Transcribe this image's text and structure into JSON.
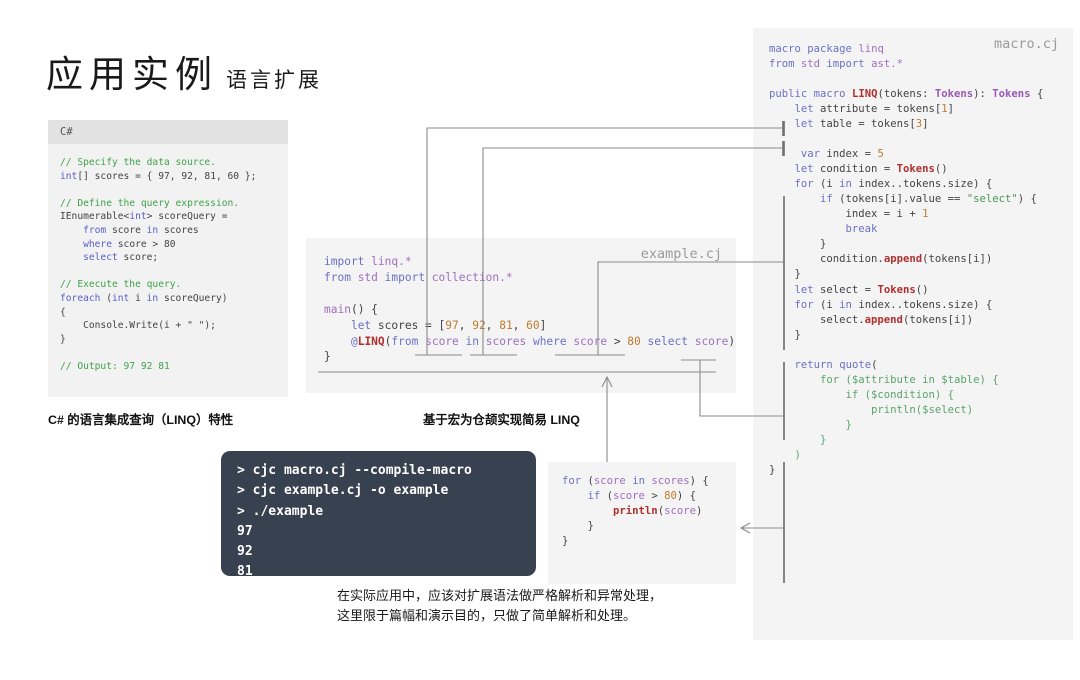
{
  "title": {
    "main": "应用实例",
    "sub": "语言扩展"
  },
  "csharp_panel": {
    "header": "C#",
    "lines": [
      [
        {
          "t": "// Specify the data source.",
          "c": "cm"
        }
      ],
      [
        {
          "t": "int",
          "c": "kb"
        },
        {
          "t": "[] scores = { ",
          "c": "pl"
        },
        {
          "t": "97",
          "c": "pl"
        },
        {
          "t": ", 92, 81, 60 };",
          "c": "pl"
        }
      ],
      [
        {
          "t": "",
          "c": "pl"
        }
      ],
      [
        {
          "t": "// Define the query expression.",
          "c": "cm"
        }
      ],
      [
        {
          "t": "IEnumerable<",
          "c": "pl"
        },
        {
          "t": "int",
          "c": "kb"
        },
        {
          "t": "> scoreQuery =",
          "c": "pl"
        }
      ],
      [
        {
          "t": "    ",
          "c": "pl"
        },
        {
          "t": "from",
          "c": "kb"
        },
        {
          "t": " score ",
          "c": "pl"
        },
        {
          "t": "in",
          "c": "kb"
        },
        {
          "t": " scores",
          "c": "pl"
        }
      ],
      [
        {
          "t": "    ",
          "c": "pl"
        },
        {
          "t": "where",
          "c": "kb"
        },
        {
          "t": " score > 80",
          "c": "pl"
        }
      ],
      [
        {
          "t": "    ",
          "c": "pl"
        },
        {
          "t": "select",
          "c": "kb"
        },
        {
          "t": " score;",
          "c": "pl"
        }
      ],
      [
        {
          "t": "",
          "c": "pl"
        }
      ],
      [
        {
          "t": "// Execute the query.",
          "c": "cm"
        }
      ],
      [
        {
          "t": "foreach",
          "c": "kb"
        },
        {
          "t": " (",
          "c": "pl"
        },
        {
          "t": "int",
          "c": "kb"
        },
        {
          "t": " i ",
          "c": "pl"
        },
        {
          "t": "in",
          "c": "kb"
        },
        {
          "t": " scoreQuery)",
          "c": "pl"
        }
      ],
      [
        {
          "t": "{",
          "c": "pl"
        }
      ],
      [
        {
          "t": "    Console.Write(i + \" \");",
          "c": "pl"
        }
      ],
      [
        {
          "t": "}",
          "c": "pl"
        }
      ],
      [
        {
          "t": "",
          "c": "pl"
        }
      ],
      [
        {
          "t": "// Output: 97 92 81",
          "c": "cm"
        }
      ]
    ]
  },
  "example_panel": {
    "filename": "example.cj",
    "lines": [
      [
        {
          "t": "import",
          "c": "k"
        },
        {
          "t": " linq.*",
          "c": "id"
        }
      ],
      [
        {
          "t": "from",
          "c": "k"
        },
        {
          "t": " std ",
          "c": "id"
        },
        {
          "t": "import",
          "c": "k"
        },
        {
          "t": " collection.*",
          "c": "id"
        }
      ],
      [
        {
          "t": "",
          "c": "pl"
        }
      ],
      [
        {
          "t": "main",
          "c": "id"
        },
        {
          "t": "() {",
          "c": "pl"
        }
      ],
      [
        {
          "t": "    ",
          "c": "pl"
        },
        {
          "t": "let",
          "c": "k"
        },
        {
          "t": " scores = [",
          "c": "pl"
        },
        {
          "t": "97",
          "c": "num"
        },
        {
          "t": ", ",
          "c": "pl"
        },
        {
          "t": "92",
          "c": "num"
        },
        {
          "t": ", ",
          "c": "pl"
        },
        {
          "t": "81",
          "c": "num"
        },
        {
          "t": ", ",
          "c": "pl"
        },
        {
          "t": "60",
          "c": "num"
        },
        {
          "t": "]",
          "c": "pl"
        }
      ],
      [
        {
          "t": "    ",
          "c": "pl"
        },
        {
          "t": "@",
          "c": "k"
        },
        {
          "t": "LINQ",
          "c": "fn"
        },
        {
          "t": "(",
          "c": "pl"
        },
        {
          "t": "from",
          "c": "k"
        },
        {
          "t": " ",
          "c": "pl"
        },
        {
          "t": "score",
          "c": "id"
        },
        {
          "t": " ",
          "c": "pl"
        },
        {
          "t": "in",
          "c": "k"
        },
        {
          "t": " ",
          "c": "pl"
        },
        {
          "t": "scores",
          "c": "id"
        },
        {
          "t": " ",
          "c": "pl"
        },
        {
          "t": "where",
          "c": "k"
        },
        {
          "t": " ",
          "c": "pl"
        },
        {
          "t": "score",
          "c": "id"
        },
        {
          "t": " > ",
          "c": "pl"
        },
        {
          "t": "80",
          "c": "num"
        },
        {
          "t": " ",
          "c": "pl"
        },
        {
          "t": "select",
          "c": "k"
        },
        {
          "t": " ",
          "c": "pl"
        },
        {
          "t": "score",
          "c": "id"
        },
        {
          "t": ")",
          "c": "pl"
        }
      ],
      [
        {
          "t": "}",
          "c": "pl"
        }
      ]
    ]
  },
  "macro_panel": {
    "filename": "macro.cj",
    "lines": [
      [
        {
          "t": "macro",
          "c": "k"
        },
        {
          "t": " ",
          "c": "pl"
        },
        {
          "t": "package",
          "c": "k"
        },
        {
          "t": " linq",
          "c": "id"
        }
      ],
      [
        {
          "t": "from",
          "c": "k"
        },
        {
          "t": " std ",
          "c": "id"
        },
        {
          "t": "import",
          "c": "k"
        },
        {
          "t": " ast.*",
          "c": "id"
        }
      ],
      [
        {
          "t": "",
          "c": "pl"
        }
      ],
      [
        {
          "t": "public",
          "c": "k"
        },
        {
          "t": " ",
          "c": "pl"
        },
        {
          "t": "macro",
          "c": "k"
        },
        {
          "t": " ",
          "c": "pl"
        },
        {
          "t": "LINQ",
          "c": "fn"
        },
        {
          "t": "(tokens: ",
          "c": "pl"
        },
        {
          "t": "Tokens",
          "c": "ty"
        },
        {
          "t": "): ",
          "c": "pl"
        },
        {
          "t": "Tokens",
          "c": "ty"
        },
        {
          "t": " {",
          "c": "pl"
        }
      ],
      [
        {
          "t": "    ",
          "c": "pl"
        },
        {
          "t": "let",
          "c": "k"
        },
        {
          "t": " attribute = tokens[",
          "c": "pl"
        },
        {
          "t": "1",
          "c": "num"
        },
        {
          "t": "]",
          "c": "pl"
        }
      ],
      [
        {
          "t": "    ",
          "c": "pl"
        },
        {
          "t": "let",
          "c": "k"
        },
        {
          "t": " table = tokens[",
          "c": "pl"
        },
        {
          "t": "3",
          "c": "num"
        },
        {
          "t": "]",
          "c": "pl"
        }
      ],
      [
        {
          "t": "",
          "c": "pl"
        }
      ],
      [
        {
          "t": "     ",
          "c": "pl"
        },
        {
          "t": "var",
          "c": "k"
        },
        {
          "t": " index = ",
          "c": "pl"
        },
        {
          "t": "5",
          "c": "num"
        }
      ],
      [
        {
          "t": "    ",
          "c": "pl"
        },
        {
          "t": "let",
          "c": "k"
        },
        {
          "t": " condition = ",
          "c": "pl"
        },
        {
          "t": "Tokens",
          "c": "fn"
        },
        {
          "t": "()",
          "c": "pl"
        }
      ],
      [
        {
          "t": "    ",
          "c": "pl"
        },
        {
          "t": "for",
          "c": "k"
        },
        {
          "t": " (i ",
          "c": "pl"
        },
        {
          "t": "in",
          "c": "k"
        },
        {
          "t": " index..tokens.size) {",
          "c": "pl"
        }
      ],
      [
        {
          "t": "        ",
          "c": "pl"
        },
        {
          "t": "if",
          "c": "k"
        },
        {
          "t": " (tokens[i].value == ",
          "c": "pl"
        },
        {
          "t": "\"select\"",
          "c": "st"
        },
        {
          "t": ") {",
          "c": "pl"
        }
      ],
      [
        {
          "t": "            index = i + ",
          "c": "pl"
        },
        {
          "t": "1",
          "c": "num"
        }
      ],
      [
        {
          "t": "            ",
          "c": "pl"
        },
        {
          "t": "break",
          "c": "k"
        }
      ],
      [
        {
          "t": "        }",
          "c": "pl"
        }
      ],
      [
        {
          "t": "        condition.",
          "c": "pl"
        },
        {
          "t": "append",
          "c": "fn"
        },
        {
          "t": "(tokens[i])",
          "c": "pl"
        }
      ],
      [
        {
          "t": "    }",
          "c": "pl"
        }
      ],
      [
        {
          "t": "    ",
          "c": "pl"
        },
        {
          "t": "let",
          "c": "k"
        },
        {
          "t": " select = ",
          "c": "pl"
        },
        {
          "t": "Tokens",
          "c": "fn"
        },
        {
          "t": "()",
          "c": "pl"
        }
      ],
      [
        {
          "t": "    ",
          "c": "pl"
        },
        {
          "t": "for",
          "c": "k"
        },
        {
          "t": " (i ",
          "c": "pl"
        },
        {
          "t": "in",
          "c": "k"
        },
        {
          "t": " index..tokens.size) {",
          "c": "pl"
        }
      ],
      [
        {
          "t": "        select.",
          "c": "pl"
        },
        {
          "t": "append",
          "c": "fn"
        },
        {
          "t": "(tokens[i])",
          "c": "pl"
        }
      ],
      [
        {
          "t": "    }",
          "c": "pl"
        }
      ],
      [
        {
          "t": "",
          "c": "pl"
        }
      ],
      [
        {
          "t": "    ",
          "c": "pl"
        },
        {
          "t": "return",
          "c": "k"
        },
        {
          "t": " ",
          "c": "pl"
        },
        {
          "t": "quote",
          "c": "k"
        },
        {
          "t": "(",
          "c": "pl"
        }
      ],
      [
        {
          "t": "        for ($attribute in $table) {",
          "c": "gr"
        }
      ],
      [
        {
          "t": "            if ($condition) {",
          "c": "gr"
        }
      ],
      [
        {
          "t": "                println($select)",
          "c": "gr"
        }
      ],
      [
        {
          "t": "            }",
          "c": "gr"
        }
      ],
      [
        {
          "t": "        }",
          "c": "gr"
        }
      ],
      [
        {
          "t": "    )",
          "c": "gr"
        }
      ],
      [
        {
          "t": "}",
          "c": "pl"
        }
      ]
    ]
  },
  "expanded_panel": {
    "lines": [
      [
        {
          "t": "for",
          "c": "k"
        },
        {
          "t": " (",
          "c": "pl"
        },
        {
          "t": "score",
          "c": "id"
        },
        {
          "t": " ",
          "c": "pl"
        },
        {
          "t": "in",
          "c": "k"
        },
        {
          "t": " ",
          "c": "pl"
        },
        {
          "t": "scores",
          "c": "id"
        },
        {
          "t": ") {",
          "c": "pl"
        }
      ],
      [
        {
          "t": "    ",
          "c": "pl"
        },
        {
          "t": "if",
          "c": "k"
        },
        {
          "t": " (",
          "c": "pl"
        },
        {
          "t": "score",
          "c": "id"
        },
        {
          "t": " > ",
          "c": "pl"
        },
        {
          "t": "80",
          "c": "num"
        },
        {
          "t": ") {",
          "c": "pl"
        }
      ],
      [
        {
          "t": "        ",
          "c": "pl"
        },
        {
          "t": "println",
          "c": "fn"
        },
        {
          "t": "(",
          "c": "pl"
        },
        {
          "t": "score",
          "c": "id"
        },
        {
          "t": ")",
          "c": "pl"
        }
      ],
      [
        {
          "t": "    }",
          "c": "pl"
        }
      ],
      [
        {
          "t": "}",
          "c": "pl"
        }
      ]
    ]
  },
  "terminal": {
    "lines": [
      "> cjc macro.cj --compile-macro",
      "> cjc example.cj -o example",
      "> ./example",
      "97",
      "92",
      "81"
    ]
  },
  "captions": {
    "csharp": "C#  的语言集成查询（LINQ）特性",
    "cangjie": "基于宏为仓颉实现简易  LINQ"
  },
  "note": {
    "line1": "在实际应用中，应该对扩展语法做严格解析和异常处理，",
    "line2": "这里限于篇幅和演示目的，只做了简单解析和处理。"
  },
  "colors": {
    "panel_bg": "#f4f4f4",
    "terminal_bg": "#38414f",
    "connector": "#8a8a8a",
    "keyword": "#6c71c4",
    "comment": "#3fa34a",
    "number": "#c07a2c",
    "type": "#9b59b6",
    "function": "#b03030",
    "quote_block": "#5aa469"
  }
}
